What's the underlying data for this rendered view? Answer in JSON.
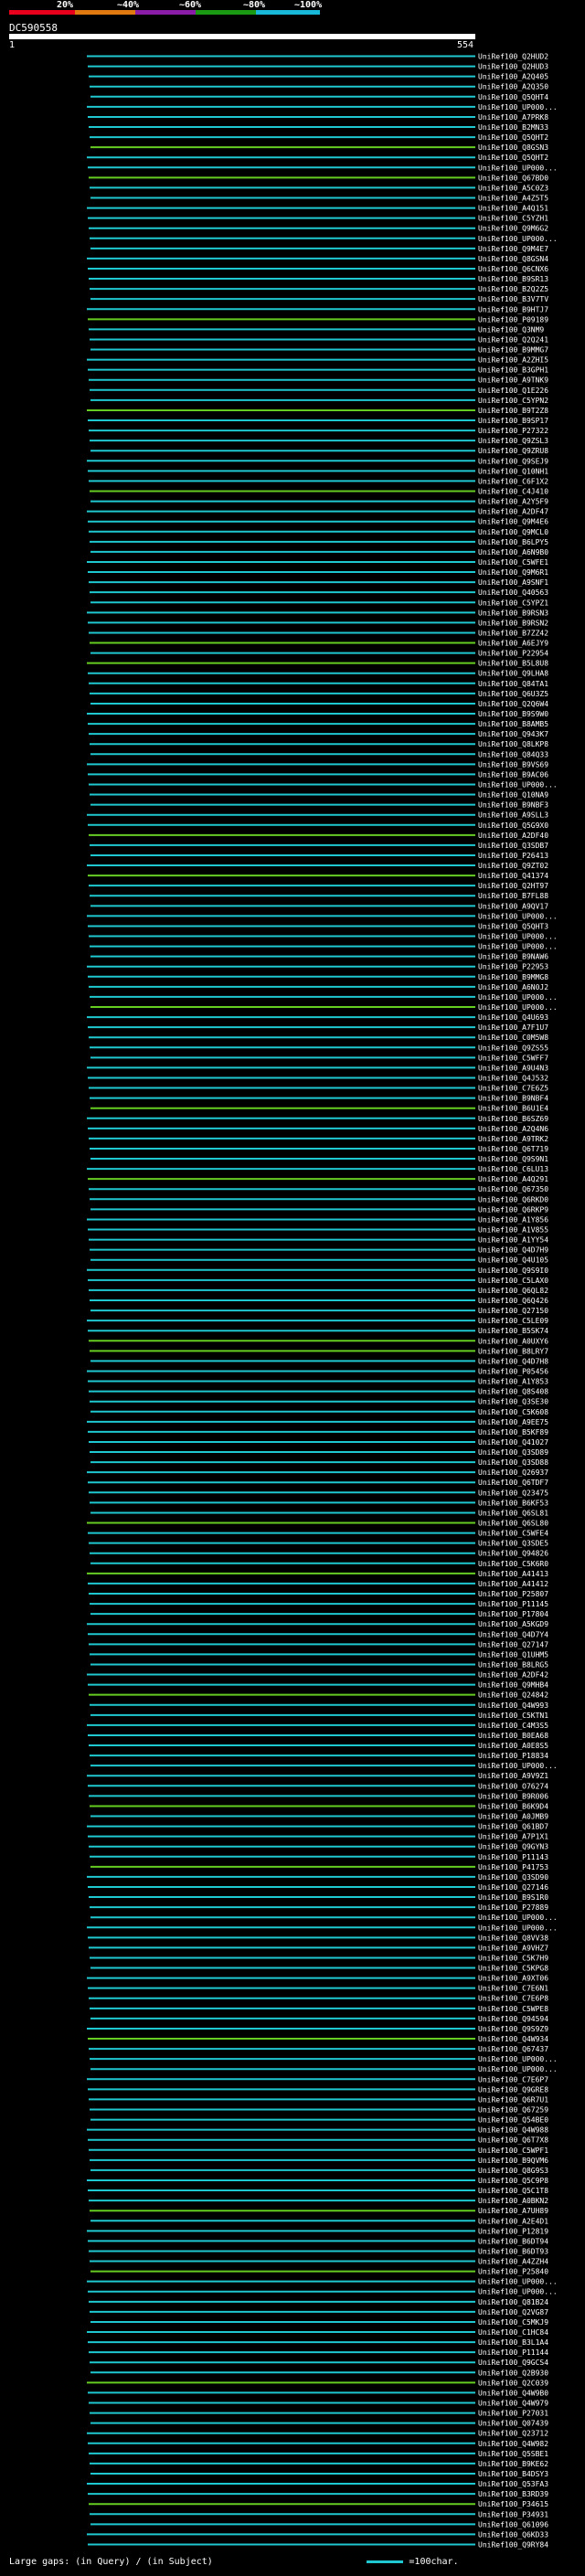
{
  "legend": {
    "labels": [
      "20%",
      "~40%",
      "~60%",
      "~80%",
      "~100%"
    ],
    "colors": [
      "#e8001c",
      "#e07a10",
      "#8a1ca8",
      "#1a9a12",
      "#18b8d8"
    ]
  },
  "title": "DC590558",
  "axis": {
    "start": "1",
    "end": "554"
  },
  "footer": {
    "gaps_prefix": "Large gaps:",
    "gaps_query": "(in Query)",
    "gaps_subject": "(in Subject)",
    "scale_text": "=100char."
  },
  "chart_data": {
    "type": "alignment",
    "query_length": 554,
    "hits": [
      "UniRef100_Q2HUD2",
      "UniRef100_Q2HUD3",
      "UniRef100_A2Q405",
      "UniRef100_A2Q350",
      "UniRef100_Q5QHT4",
      "UniRef100_UP000...",
      "UniRef100_A7PRK8",
      "UniRef100_B2MN33",
      "UniRef100_Q5QHT2",
      "UniRef100_Q8GSN3",
      "UniRef100_Q5QHT2",
      "UniRef100_UP000...",
      "UniRef100_Q67BD0",
      "UniRef100_A5C0Z3",
      "UniRef100_A4Z5T5",
      "UniRef100_A4Q151",
      "UniRef100_C5YZH1",
      "UniRef100_Q9M6G2",
      "UniRef100_UP000...",
      "UniRef100_Q9M4E7",
      "UniRef100_Q8GSN4",
      "UniRef100_Q6CNX6",
      "UniRef100_B9SR13",
      "UniRef100_B2Q2Z5",
      "UniRef100_B3V7TV",
      "UniRef100_B9HTJ7",
      "UniRef100_P09189",
      "UniRef100_Q3NM9",
      "UniRef100_Q2Q241",
      "UniRef100_B9MMG7",
      "UniRef100_A2ZHI5",
      "UniRef100_B3GPH1",
      "UniRef100_A9TNK9",
      "UniRef100_Q1E226",
      "UniRef100_C5YPN2",
      "UniRef100_B9T2Z8",
      "UniRef100_B9SP17",
      "UniRef100_P27322",
      "UniRef100_Q9ZSL3",
      "UniRef100_Q9ZRU8",
      "UniRef100_Q9SEJ9",
      "UniRef100_Q10NH1",
      "UniRef100_C6F1X2",
      "UniRef100_C4J410",
      "UniRef100_A2Y5F9",
      "UniRef100_A2DF47",
      "UniRef100_Q9M4E6",
      "UniRef100_Q9MCL0",
      "UniRef100_B6LPY5",
      "UniRef100_A6N9B0",
      "UniRef100_C5WFE1",
      "UniRef100_Q9M6R1",
      "UniRef100_A9SNF1",
      "UniRef100_Q40563",
      "UniRef100_C5YPZ1",
      "UniRef100_B9RSN3",
      "UniRef100_B9RSN2",
      "UniRef100_B7ZZ42",
      "UniRef100_A6EJY9",
      "UniRef100_P22954",
      "UniRef100_B5L8U8",
      "UniRef100_Q9LHA8",
      "UniRef100_Q84TA1",
      "UniRef100_Q6U3Z5",
      "UniRef100_Q2Q6W4",
      "UniRef100_B9S9W0",
      "UniRef100_B8AMB5",
      "UniRef100_Q943K7",
      "UniRef100_Q8LKP8",
      "UniRef100_Q84Q33",
      "UniRef100_B9VS69",
      "UniRef100_B9AC06",
      "UniRef100_UP000...",
      "UniRef100_Q10NA9",
      "UniRef100_B9NBF3",
      "UniRef100_A9SLL3",
      "UniRef100_Q5G9X0",
      "UniRef100_A2DF40",
      "UniRef100_Q3SDB7",
      "UniRef100_P26413",
      "UniRef100_Q9ZT02",
      "UniRef100_Q41374",
      "UniRef100_Q2HT97",
      "UniRef100_B7FL88",
      "UniRef100_A9QV17",
      "UniRef100_UP000...",
      "UniRef100_Q5QHT3",
      "UniRef100_UP000...",
      "UniRef100_UP000...",
      "UniRef100_B9NAW6",
      "UniRef100_P22953",
      "UniRef100_B9MMG8",
      "UniRef100_A6N0J2",
      "UniRef100_UP000...",
      "UniRef100_UP000...",
      "UniRef100_Q4U693",
      "UniRef100_A7F1U7",
      "UniRef100_C0M5W8",
      "UniRef100_Q9ZS55",
      "UniRef100_C5WFF7",
      "UniRef100_A9U4N3",
      "UniRef100_Q4J532",
      "UniRef100_C7E6Z5",
      "UniRef100_B9NBF4",
      "UniRef100_B6U1E4",
      "UniRef100_B6SZ69",
      "UniRef100_A2Q4N6",
      "UniRef100_A9TRK2",
      "UniRef100_Q6T719",
      "UniRef100_Q9S9N1",
      "UniRef100_C6LU13",
      "UniRef100_A4Q291",
      "UniRef100_Q67350",
      "UniRef100_Q6RKD0",
      "UniRef100_Q6RKP9",
      "UniRef100_A1Y856",
      "UniRef100_A1V855",
      "UniRef100_A1YY54",
      "UniRef100_Q4D7H9",
      "UniRef100_Q4U105",
      "UniRef100_Q9S9I0",
      "UniRef100_C5LAX0",
      "UniRef100_Q6QL82",
      "UniRef100_Q6Q426",
      "UniRef100_Q27150",
      "UniRef100_C5LE09",
      "UniRef100_B5SK74",
      "UniRef100_A0UXY6",
      "UniRef100_B8LRY7",
      "UniRef100_Q4D7H8",
      "UniRef100_P05456",
      "UniRef100_A1Y853",
      "UniRef100_Q8S408",
      "UniRef100_Q3SE30",
      "UniRef100_C5K608",
      "UniRef100_A9EE75",
      "UniRef100_B5KF89",
      "UniRef100_Q41027",
      "UniRef100_Q3SD89",
      "UniRef100_Q3SD88",
      "UniRef100_Q26937",
      "UniRef100_Q6TDF7",
      "UniRef100_Q23475",
      "UniRef100_B6KF53",
      "UniRef100_Q6SL81",
      "UniRef100_Q6SL80",
      "UniRef100_C5WFE4",
      "UniRef100_Q3SDE5",
      "UniRef100_Q94826",
      "UniRef100_C5K6R0",
      "UniRef100_A41413",
      "UniRef100_A41412",
      "UniRef100_P25807",
      "UniRef100_P11145",
      "UniRef100_P17804",
      "UniRef100_A5KGD9",
      "UniRef100_Q4D7Y4",
      "UniRef100_Q27147",
      "UniRef100_Q1UHM5",
      "UniRef100_B8LRG5",
      "UniRef100_A2DF42",
      "UniRef100_Q9MHB4",
      "UniRef100_Q24842",
      "UniRef100_Q4W993",
      "UniRef100_C5KTN1",
      "UniRef100_C4M3S5",
      "UniRef100_B0EA68",
      "UniRef100_A0E8S5",
      "UniRef100_P18834",
      "UniRef100_UP000...",
      "UniRef100_A9V9Z1",
      "UniRef100_O76274",
      "UniRef100_B9R006",
      "UniRef100_B6K9D4",
      "UniRef100_A0JMB9",
      "UniRef100_Q61BD7",
      "UniRef100_A7P1X1",
      "UniRef100_Q9GYN3",
      "UniRef100_P11143",
      "UniRef100_P41753",
      "UniRef100_Q3SD90",
      "UniRef100_Q27146",
      "UniRef100_B9S1R0",
      "UniRef100_P27889",
      "UniRef100_UP000...",
      "UniRef100_UP000...",
      "UniRef100_Q8VV38",
      "UniRef100_A9VHZ7",
      "UniRef100_C5K7H9",
      "UniRef100_C5KPG8",
      "UniRef100_A9XT06",
      "UniRef100_C7E6N1",
      "UniRef100_C7E6P8",
      "UniRef100_C5WPE8",
      "UniRef100_Q94594",
      "UniRef100_Q9S9Z9",
      "UniRef100_Q4W934",
      "UniRef100_Q67437",
      "UniRef100_UP000...",
      "UniRef100_UP000...",
      "UniRef100_C7E6P7",
      "UniRef100_Q9GRE8",
      "UniRef100_Q6R7U1",
      "UniRef100_Q67259",
      "UniRef100_Q54BE0",
      "UniRef100_Q4W988",
      "UniRef100_Q6T7X8",
      "UniRef100_C5WPF1",
      "UniRef100_B9QVM6",
      "UniRef100_Q8G9S3",
      "UniRef100_Q5C9P8",
      "UniRef100_Q5C1T8",
      "UniRef100_A0BKN2",
      "UniRef100_A7UH89",
      "UniRef100_A2E4D1",
      "UniRef100_P12819",
      "UniRef100_B6DT94",
      "UniRef100_B6DT93",
      "UniRef100_A4ZZH4",
      "UniRef100_P25840",
      "UniRef100_UP000...",
      "UniRef100_UP000...",
      "UniRef100_Q81B24",
      "UniRef100_Q2VG87",
      "UniRef100_C5MKJ9",
      "UniRef100_C1HC84",
      "UniRef100_B3L1A4",
      "UniRef100_P11144",
      "UniRef100_Q9GCS4",
      "UniRef100_Q2B930",
      "UniRef100_Q2C039",
      "UniRef100_Q4W9B0",
      "UniRef100_Q4W979",
      "UniRef100_P27031",
      "UniRef100_Q07439",
      "UniRef100_Q23712",
      "UniRef100_Q4W982",
      "UniRef100_Q5SBE1",
      "UniRef100_B9KE62",
      "UniRef100_B4DSY3",
      "UniRef100_Q53FA3",
      "UniRef100_B3RD39",
      "UniRef100_P34615",
      "UniRef100_P34931",
      "UniRef100_Q61096",
      "UniRef100_Q6KD33",
      "UniRef100_Q9RY84"
    ]
  }
}
